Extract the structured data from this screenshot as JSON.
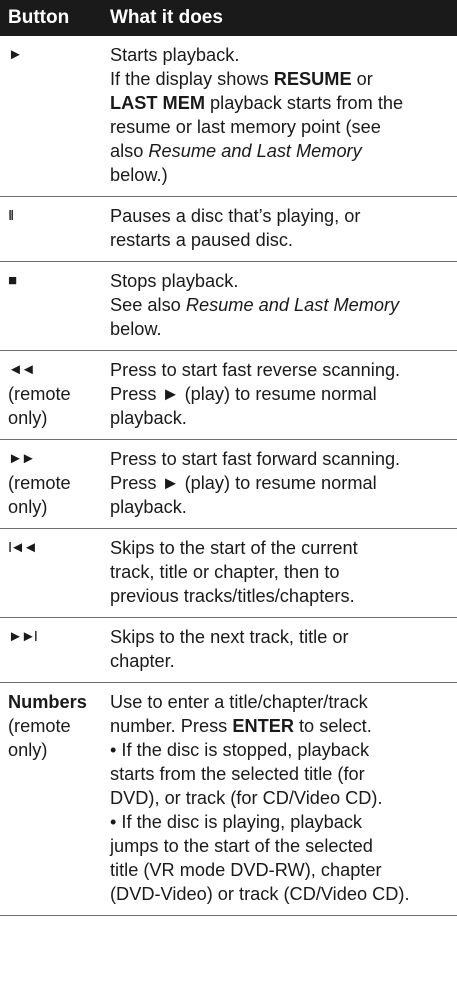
{
  "header": {
    "col1": "Button",
    "col2": "What it does"
  },
  "rows": [
    {
      "symbol": "►",
      "lines": [
        [
          "Starts playback."
        ],
        [
          "If the display shows ",
          {
            "b": "RESUME"
          },
          " or"
        ],
        [
          {
            "b": "LAST MEM"
          },
          " playback starts from the"
        ],
        [
          "resume or last memory point (see"
        ],
        [
          "also ",
          {
            "i": "Resume and Last Memory"
          }
        ],
        [
          "below.)"
        ]
      ]
    },
    {
      "symbol": "II",
      "lines": [
        [
          "Pauses a disc that’s playing, or"
        ],
        [
          "restarts a paused disc."
        ]
      ]
    },
    {
      "symbol": "■",
      "lines": [
        [
          "Stops playback."
        ],
        [
          "See also ",
          {
            "i": "Resume and Last Memory"
          }
        ],
        [
          "below."
        ]
      ]
    },
    {
      "symbol": "◄◄",
      "note": [
        "(remote",
        "only)"
      ],
      "lines": [
        [
          "Press to start fast reverse scanning."
        ],
        [
          "Press ► (play) to resume normal"
        ],
        [
          "playback."
        ]
      ]
    },
    {
      "symbol": "►►",
      "note": [
        "(remote",
        "only)"
      ],
      "lines": [
        [
          "Press to start fast forward scanning."
        ],
        [
          "Press ► (play) to resume normal"
        ],
        [
          "playback."
        ]
      ]
    },
    {
      "symbol": "I◄◄",
      "lines": [
        [
          "Skips to the start of the current"
        ],
        [
          "track, title or chapter, then to"
        ],
        [
          "previous tracks/titles/chapters."
        ]
      ]
    },
    {
      "symbol": "►►I",
      "lines": [
        [
          "Skips to the next track, title or"
        ],
        [
          "chapter."
        ]
      ]
    },
    {
      "word": "Numbers",
      "note": [
        "(remote",
        "only)"
      ],
      "lines": [
        [
          "Use to enter a title/chapter/track"
        ],
        [
          "number. Press ",
          {
            "b": "ENTER"
          },
          " to select."
        ],
        [
          "• If the disc is stopped, playback"
        ],
        [
          "starts from the selected title (for"
        ],
        [
          "DVD), or track (for CD/Video CD)."
        ],
        [
          "• If the disc is playing, playback"
        ],
        [
          "jumps to the start of the selected"
        ],
        [
          "title (VR mode DVD-RW), chapter"
        ],
        [
          "(DVD-Video) or track (CD/Video CD)."
        ]
      ]
    }
  ]
}
